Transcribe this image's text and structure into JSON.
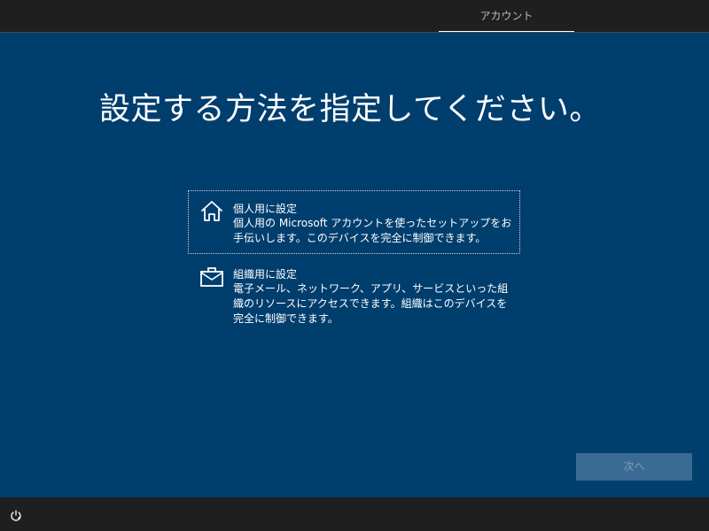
{
  "header": {
    "tabs": [
      {
        "label": "アカウント",
        "active": true
      }
    ]
  },
  "main": {
    "title": "設定する方法を指定してください。",
    "options": [
      {
        "icon": "home-icon",
        "title": "個人用に設定",
        "description": "個人用の Microsoft アカウントを使ったセットアップをお手伝いします。このデバイスを完全に制御できます。",
        "selected": true
      },
      {
        "icon": "briefcase-icon",
        "title": "組織用に設定",
        "description": "電子メール、ネットワーク、アプリ、サービスといった組織のリソースにアクセスできます。組織はこのデバイスを完全に制御できます。",
        "selected": false
      }
    ],
    "next_label": "次へ"
  },
  "footer": {
    "icon": "accessibility-icon"
  },
  "colors": {
    "background": "#003e6e",
    "bar": "#1f1f1f",
    "button": "#3a6b94"
  }
}
